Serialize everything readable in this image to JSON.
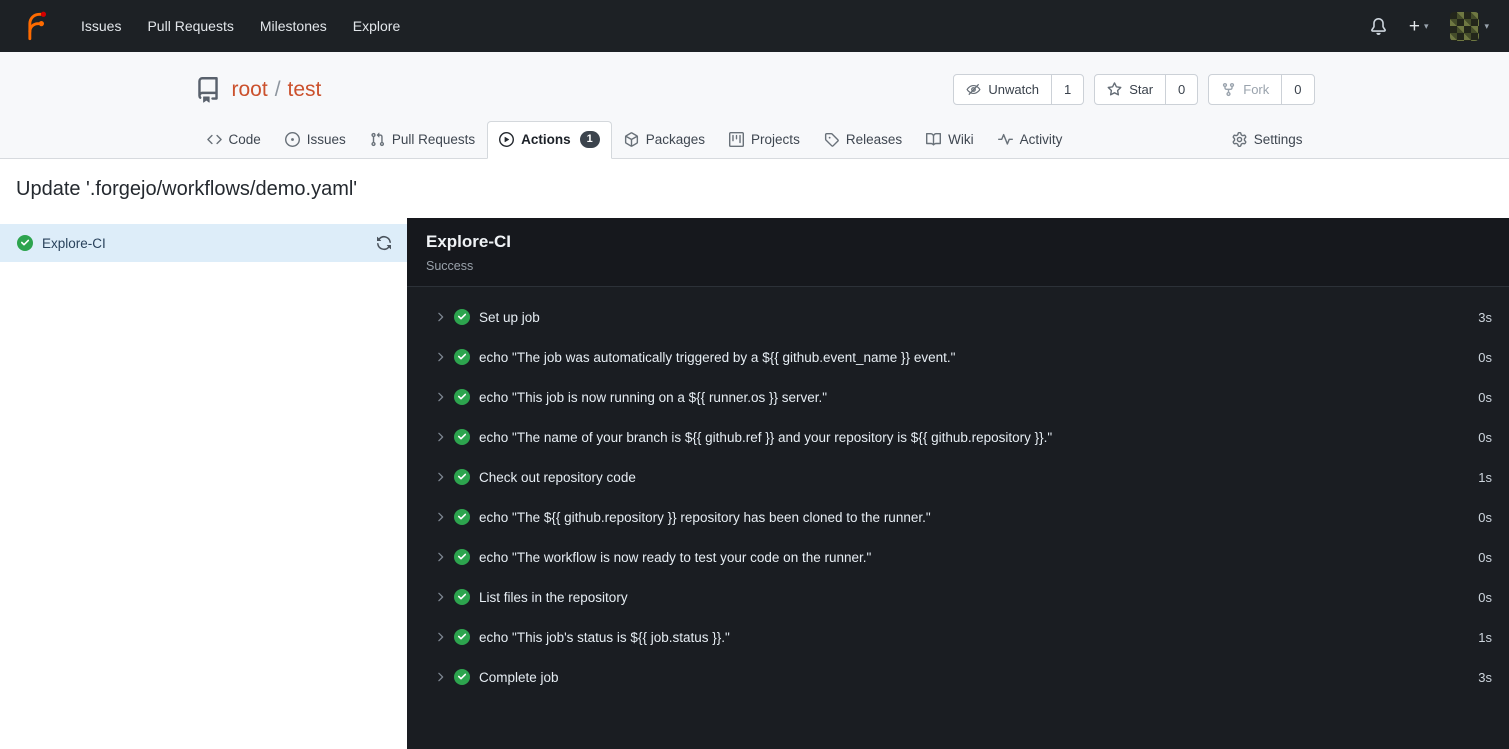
{
  "colors": {
    "accent_orange": "#cb512d",
    "success_green": "#2da44e",
    "navbar_bg": "#1d2125",
    "log_panel_bg": "#1a1d22",
    "active_job_bg": "#ddedf9"
  },
  "navbar": {
    "items": [
      "Issues",
      "Pull Requests",
      "Milestones",
      "Explore"
    ],
    "plus_label": "+",
    "caret": "▾"
  },
  "repo_header": {
    "owner": "root",
    "separator": "/",
    "name": "test",
    "buttons": [
      {
        "label": "Unwatch",
        "count": "1"
      },
      {
        "label": "Star",
        "count": "0"
      },
      {
        "label": "Fork",
        "count": "0"
      }
    ]
  },
  "tabs": {
    "items": [
      "Code",
      "Issues",
      "Pull Requests",
      "Actions",
      "Packages",
      "Projects",
      "Releases",
      "Wiki",
      "Activity",
      "Settings"
    ],
    "actions_badge": "1"
  },
  "run": {
    "title": "Update '.forgejo/workflows/demo.yaml'",
    "sidebar": {
      "job_name": "Explore-CI"
    },
    "log": {
      "title": "Explore-CI",
      "status": "Success",
      "steps": [
        {
          "name": "Set up job",
          "duration": "3s"
        },
        {
          "name": "echo \"The job was automatically triggered by a ${{ github.event_name }} event.\"",
          "duration": "0s"
        },
        {
          "name": "echo \"This job is now running on a ${{ runner.os }} server.\"",
          "duration": "0s"
        },
        {
          "name": "echo \"The name of your branch is ${{ github.ref }} and your repository is ${{ github.repository }}.\"",
          "duration": "0s"
        },
        {
          "name": "Check out repository code",
          "duration": "1s"
        },
        {
          "name": "echo \"The ${{ github.repository }} repository has been cloned to the runner.\"",
          "duration": "0s"
        },
        {
          "name": "echo \"The workflow is now ready to test your code on the runner.\"",
          "duration": "0s"
        },
        {
          "name": "List files in the repository",
          "duration": "0s"
        },
        {
          "name": "echo \"This job's status is ${{ job.status }}.\"",
          "duration": "1s"
        },
        {
          "name": "Complete job",
          "duration": "3s"
        }
      ]
    }
  }
}
